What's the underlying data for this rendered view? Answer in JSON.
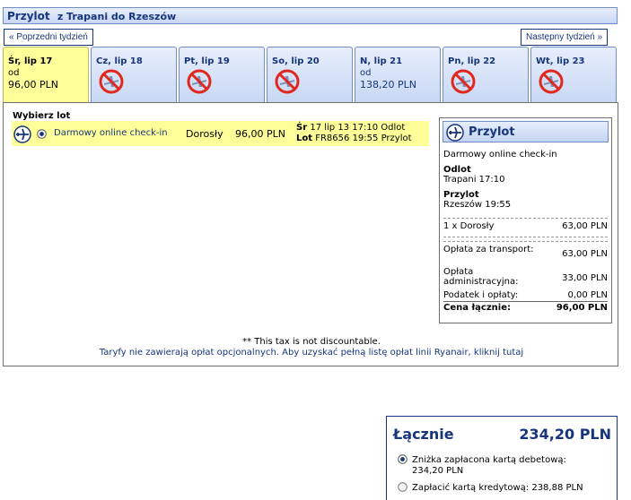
{
  "header": {
    "title": "Przylot",
    "route": "z Trapani do Rzeszów"
  },
  "nav": {
    "prev_week": "« Poprzedni tydzień",
    "next_week": "Następny tydzień »"
  },
  "date_tabs": [
    {
      "day": "Śr, lip 17",
      "od": "od",
      "price": "96,00 PLN",
      "selected": true,
      "available": true
    },
    {
      "day": "Cz, lip 18",
      "od": "",
      "price": "",
      "selected": false,
      "available": false
    },
    {
      "day": "Pt, lip 19",
      "od": "",
      "price": "",
      "selected": false,
      "available": false
    },
    {
      "day": "So, lip 20",
      "od": "",
      "price": "",
      "selected": false,
      "available": false
    },
    {
      "day": "N, lip 21",
      "od": "od",
      "price": "138,20 PLN",
      "selected": false,
      "available": true
    },
    {
      "day": "Pn, lip 22",
      "od": "",
      "price": "",
      "selected": false,
      "available": false
    },
    {
      "day": "Wt, lip 23",
      "od": "",
      "price": "",
      "selected": false,
      "available": false
    }
  ],
  "flight_list": {
    "title": "Wybierz lot",
    "flights": [
      {
        "fare_type": "Darmowy online check-in",
        "passenger": "Dorosły",
        "price": "96,00 PLN",
        "date_label": "Śr",
        "date": "17 lip 13",
        "depart_time": "17:10",
        "depart_label": "Odlot",
        "flight_label": "Lot",
        "flight_number": "FR8656",
        "arrive_time": "19:55",
        "arrive_label": "Przylot"
      }
    ]
  },
  "summary": {
    "title": "Przylot",
    "fare_type": "Darmowy online check-in",
    "depart_heading": "Odlot",
    "depart_detail": "Trapani 17:10",
    "arrive_heading": "Przylot",
    "arrive_detail": "Rzeszów 19:55",
    "rows": [
      {
        "label": "1 x Dorosły",
        "value": "63,00 PLN"
      },
      {
        "label": "Opłata za transport:",
        "value": "63,00 PLN"
      },
      {
        "label": "Opłata administracyjna:",
        "value": "33,00 PLN"
      },
      {
        "label": "Podatek i opłaty:",
        "value": "0,00 PLN"
      }
    ],
    "total_label": "Cena łącznie:",
    "total_value": "96,00 PLN"
  },
  "notes": {
    "tax": "** This tax is not discountable.",
    "fees_link": "Taryfy nie zawierają opłat opcjonalnych. Aby uzyskać pełną listę opłat linii Ryanair, kliknij tutaj"
  },
  "totals": {
    "label": "Łącznie",
    "amount": "234,20 PLN",
    "options": [
      {
        "text": "Zniżka zapłacona kartą debetową: 234,20 PLN",
        "selected": true
      },
      {
        "text": "Zapłacić kartą kredytową: 238,88 PLN",
        "selected": false
      }
    ]
  },
  "colors": {
    "brand": "#16357a",
    "highlight": "#ffff99",
    "tab_bg": "#c8d8f4",
    "no_flight": "#e0281e"
  }
}
